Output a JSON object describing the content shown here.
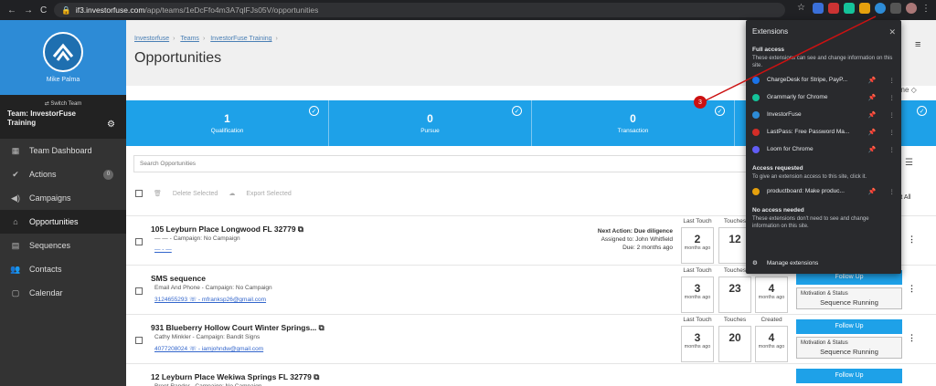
{
  "browser": {
    "url_host": "if3.investorfuse.com",
    "url_path": "/app/teams/1eDcFfo4m3A7qlFJs05V/opportunities"
  },
  "sidebar": {
    "user_name": "Mike Palma",
    "switch_team": "⇄ Switch Team",
    "team_name": "Team: InvestorFuse Training",
    "items": [
      {
        "icon": "dashboard-icon",
        "label": "Team Dashboard"
      },
      {
        "icon": "check-circle-icon",
        "label": "Actions",
        "badge": "0"
      },
      {
        "icon": "megaphone-icon",
        "label": "Campaigns"
      },
      {
        "icon": "home-icon",
        "label": "Opportunities"
      },
      {
        "icon": "sequence-icon",
        "label": "Sequences"
      },
      {
        "icon": "contacts-icon",
        "label": "Contacts"
      },
      {
        "icon": "calendar-icon",
        "label": "Calendar"
      }
    ]
  },
  "breadcrumb": [
    "Investorfuse",
    "Teams",
    "InvestorFuse Training"
  ],
  "page_title": "Opportunities",
  "stages": [
    {
      "count": "1",
      "label": "Qualification"
    },
    {
      "count": "0",
      "label": "Pursue"
    },
    {
      "count": "0",
      "label": "Transaction"
    }
  ],
  "search_placeholder": "Search Opportunities",
  "bulk": {
    "delete": "Delete Selected",
    "export": "Export Selected"
  },
  "sort_label": "line ◇",
  "sort_all_label": "rt All",
  "metric_labels": {
    "last_touch": "Last Touch",
    "touches": "Touches",
    "created": "Created",
    "months_ago": "months ago"
  },
  "rows": [
    {
      "title": "105 Leyburn Place Longwood FL 32779 ⧉",
      "sub": "— — - Campaign: No Campaign",
      "link": "— - —",
      "next_action": "Next Action: Due diligence",
      "assigned": "Assigned to: John Whitfield",
      "due": "Due: 2 months ago",
      "last_touch": "2",
      "touches": "12",
      "created": ""
    },
    {
      "title": "SMS sequence",
      "sub": "Email And Phone - Campaign: No Campaign",
      "link": "3124655293 ☏ - mfranksp26@gmail.com",
      "last_touch": "3",
      "touches": "23",
      "created": "4",
      "follow": "Follow Up",
      "status_label": "Motivation & Status",
      "status": "Sequence Running"
    },
    {
      "title": "931 Blueberry Hollow Court Winter Springs... ⧉",
      "sub": "Cathy Minkler - Campaign: Bandit Signs",
      "link": "4077208024 ☏ - iamjohndw@gmail.com",
      "last_touch": "3",
      "touches": "20",
      "created": "4",
      "follow": "Follow Up",
      "status_label": "Motivation & Status",
      "status": "Sequence Running"
    },
    {
      "title": "12 Leyburn Place Wekiwa Springs FL 32779 ⧉",
      "sub": "Brent Rander - Campaign: No Campaign",
      "follow": "Follow Up"
    }
  ],
  "extensions_popup": {
    "title": "Extensions",
    "full_access": "Full access",
    "full_access_desc": "These extensions can see and change information on this site.",
    "full_list": [
      {
        "name": "ChargeDesk for Stripe, PayP...",
        "color": "#1a73e8"
      },
      {
        "name": "Grammarly for Chrome",
        "color": "#15c39a"
      },
      {
        "name": "InvestorFuse",
        "color": "#2d8bd6"
      },
      {
        "name": "LastPass: Free Password Ma...",
        "color": "#d32d27"
      },
      {
        "name": "Loom for Chrome",
        "color": "#625df5"
      }
    ],
    "requested": "Access requested",
    "requested_desc": "To give an extension access to this site, click it.",
    "requested_list": [
      {
        "name": "productboard: Make produc...",
        "color": "#e5a00d"
      }
    ],
    "no_access": "No access needed",
    "no_access_desc": "These extensions don't need to see and change information on this site.",
    "manage": "Manage extensions"
  },
  "annotation_number": "3"
}
